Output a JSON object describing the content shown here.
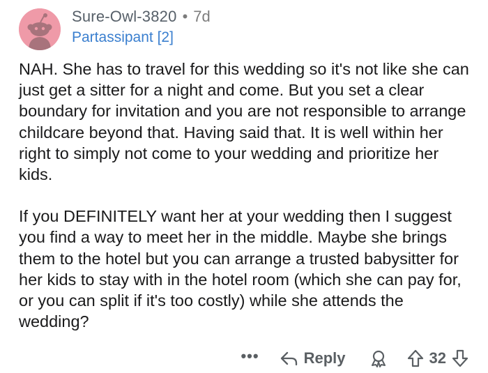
{
  "comment": {
    "username": "Sure-Owl-3820",
    "separator": "•",
    "age": "7d",
    "flair": "Partassipant [2]",
    "paragraphs": [
      "NAH. She has to travel for this  wedding so it's not like she can just get a sitter for a night and come. But you set a clear boundary for invitation and you are not responsible to arrange childcare beyond that. Having said that. It is well within her right to simply not come to your wedding and prioritize her kids.",
      "If you DEFINITELY want her at your wedding then I suggest you find a way to meet her in the middle. Maybe she brings them to the hotel but you can arrange a trusted babysitter for her kids to stay with in the hotel room (which she can pay for, or you can split if it's too costly)  while she attends the wedding?"
    ]
  },
  "actions": {
    "more": "•••",
    "reply_label": "Reply",
    "score": "32"
  },
  "colors": {
    "avatar_bg": "#ef9aa8",
    "flair": "#3a7fcf",
    "action_gray": "#5a5f63"
  },
  "icons": {
    "avatar": "snoo-avatar-icon",
    "reply": "reply-arrow-icon",
    "award": "award-icon",
    "upvote": "upvote-arrow-icon",
    "downvote": "downvote-arrow-icon"
  }
}
